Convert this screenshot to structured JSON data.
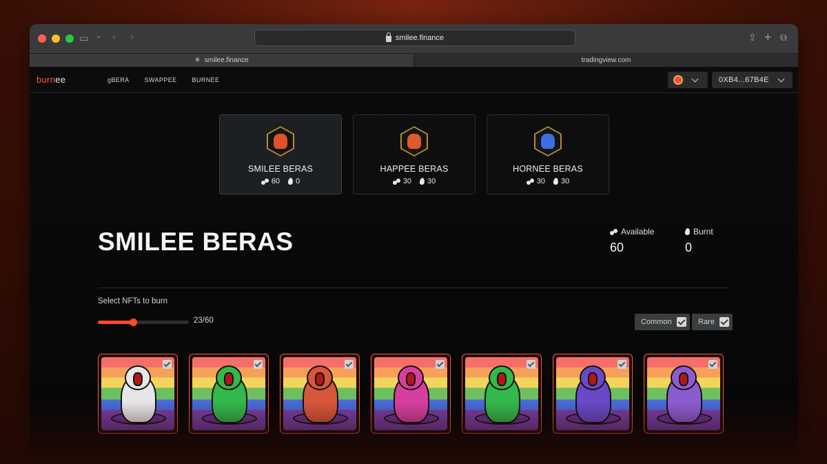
{
  "browser": {
    "url": "smilee.finance",
    "tabs": [
      {
        "label": "smilee.finance",
        "active": true
      },
      {
        "label": "tradingview.com",
        "active": false
      }
    ]
  },
  "nav": {
    "logo_burn": "burn",
    "logo_ee": "ee",
    "links": [
      "gBERA",
      "SWAPPEE",
      "BURNEE"
    ],
    "wallet": "0XB4...67B4E"
  },
  "collections": [
    {
      "name": "SMILEE BERAS",
      "available": "60",
      "burnt": "0",
      "selected": true,
      "color": "#e0522a"
    },
    {
      "name": "HAPPEE BERAS",
      "available": "30",
      "burnt": "30",
      "selected": false,
      "color": "#e05a2a"
    },
    {
      "name": "HORNEE BERAS",
      "available": "30",
      "burnt": "30",
      "selected": false,
      "color": "#3d6fe0"
    }
  ],
  "detail": {
    "title": "SMILEE BERAS",
    "available_label": "Available",
    "available_value": "60",
    "burnt_label": "Burnt",
    "burnt_value": "0",
    "select_label": "Select NFTs to burn",
    "selected_count": 23,
    "total_count": 60,
    "count_text": "23/60",
    "filters": [
      {
        "label": "Common",
        "checked": true
      },
      {
        "label": "Rare",
        "checked": true
      }
    ]
  },
  "nfts": [
    {
      "bear_color": "#e6e6e6",
      "selected": true
    },
    {
      "bear_color": "#33b84a",
      "selected": true
    },
    {
      "bear_color": "#d8573a",
      "selected": true
    },
    {
      "bear_color": "#d63fa0",
      "selected": true
    },
    {
      "bear_color": "#33b84a",
      "selected": true
    },
    {
      "bear_color": "#6a48c8",
      "selected": true
    },
    {
      "bear_color": "#8b5cd0",
      "selected": true
    }
  ],
  "colors": {
    "accent": "#ff4a2e",
    "background": "#080808"
  }
}
